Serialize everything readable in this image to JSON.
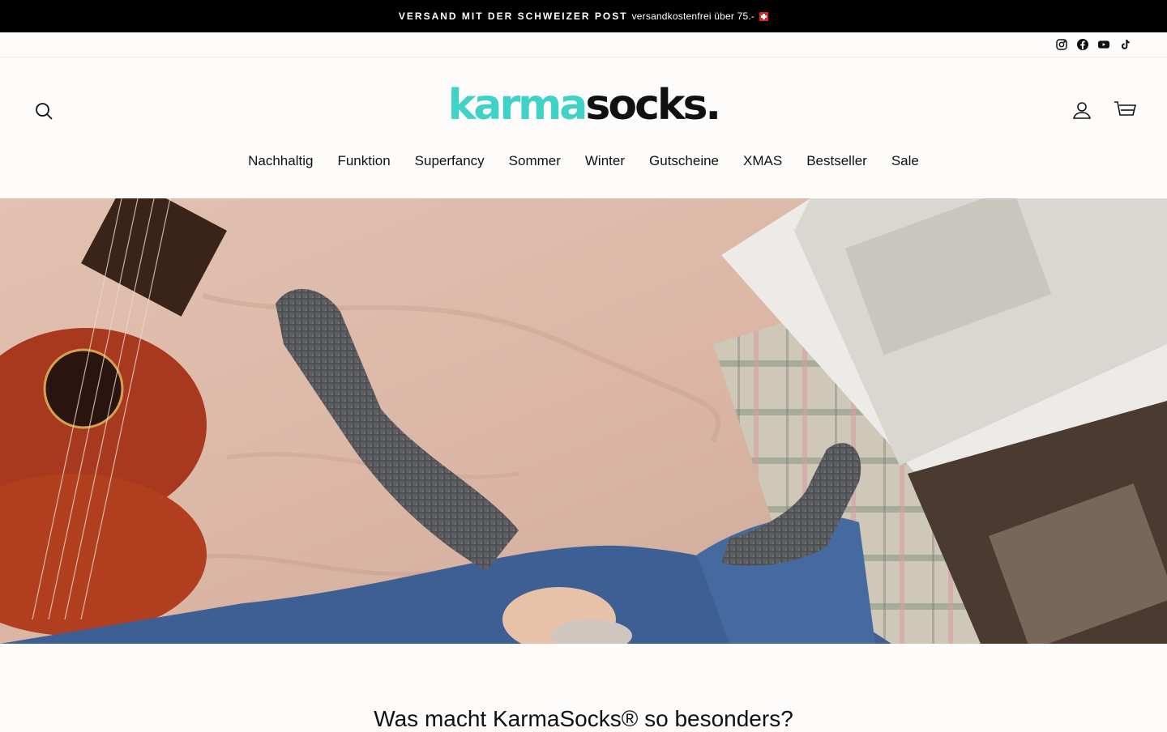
{
  "announcement": {
    "strong": "VERSAND MIT DER SCHWEIZER POST",
    "text": "versandkostenfrei über 75.-"
  },
  "social": [
    "instagram-icon",
    "facebook-icon",
    "youtube-icon",
    "tiktok-icon"
  ],
  "logo": {
    "part1": "karma",
    "part2": "socks."
  },
  "colors": {
    "brand_teal": "#3fd2c7",
    "announcement_bg": "#000000"
  },
  "nav": [
    "Nachhaltig",
    "Funktion",
    "Superfancy",
    "Sommer",
    "Winter",
    "Gutscheine",
    "XMAS",
    "Bestseller",
    "Sale"
  ],
  "section": {
    "title": "Was macht KarmaSocks® so besonders?"
  }
}
